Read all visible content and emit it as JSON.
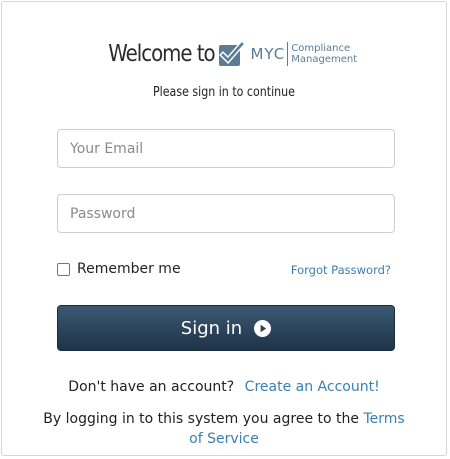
{
  "header": {
    "welcome": "Welcome to",
    "logo": {
      "brand": "MYC",
      "tagline_line1": "Compliance",
      "tagline_line2": "Management"
    },
    "subtitle": "Please sign in to continue"
  },
  "form": {
    "email_placeholder": "Your Email",
    "password_placeholder": "Password",
    "remember_label": "Remember me",
    "remember_checked": false,
    "forgot_label": "Forgot Password?",
    "signin_label": "Sign in",
    "signin_icon": "play-circle-icon"
  },
  "footer": {
    "no_account_text": "Don't have an account?",
    "create_account_label": "Create an Account!",
    "terms_prefix": "By logging in to this system you agree to the",
    "terms_link": "Terms of Service"
  },
  "colors": {
    "brand": "#5a7d95",
    "button_top": "#3c5872",
    "button_bottom": "#1e3448",
    "link": "#3b7fb0"
  }
}
